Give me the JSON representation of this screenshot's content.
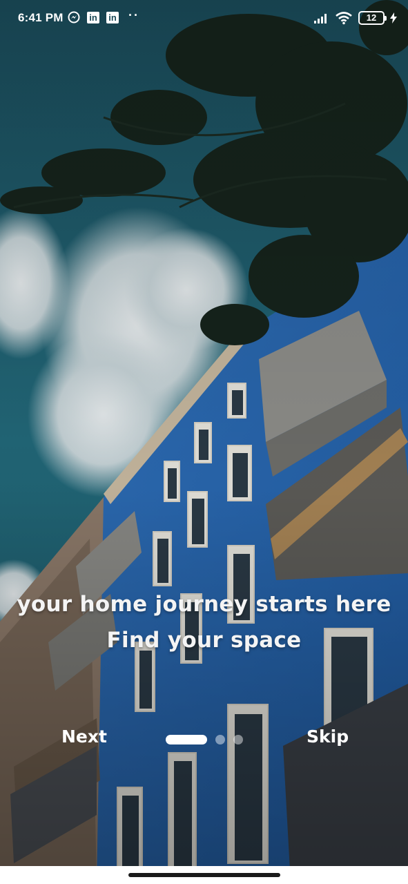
{
  "status_bar": {
    "time": "6:41 PM",
    "app_icons": [
      "messenger-icon",
      "linkedin-icon",
      "linkedin-icon"
    ],
    "linkedin_glyph": "in",
    "more_indicator": "··",
    "battery_level": "12",
    "battery_charging": true
  },
  "onboarding": {
    "headline": "your home journey starts here",
    "subheadline": "Find your space",
    "next_label": "Next",
    "skip_label": "Skip",
    "page_count": 3,
    "current_page": 1
  },
  "colors": {
    "sky": "#1f5b69",
    "building": "#2e6fb5",
    "text": "#f4f4f4"
  }
}
